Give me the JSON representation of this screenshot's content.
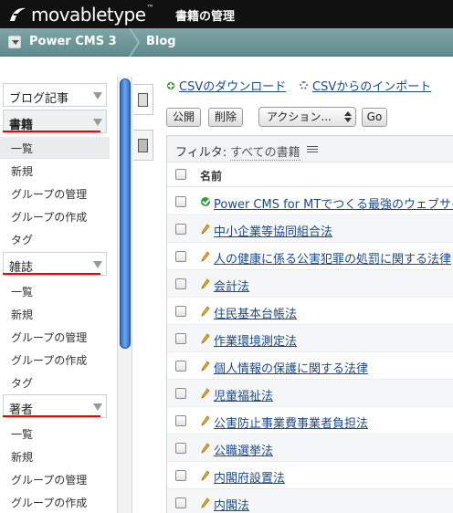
{
  "header": {
    "logo_text": "movabletype",
    "logo_tm": "™",
    "page_title": "書籍の管理"
  },
  "breadcrumb": {
    "site": "Power CMS 3",
    "blog": "Blog"
  },
  "sidebar": {
    "menus": [
      {
        "label": "ブログ記事",
        "bold": false
      },
      {
        "label": "書籍",
        "bold": true,
        "items": [
          "一覧",
          "新規",
          "グループの管理",
          "グループの作成",
          "タグ"
        ]
      },
      {
        "label": "雑誌",
        "bold": false,
        "items": [
          "一覧",
          "新規",
          "グループの管理",
          "グループの作成",
          "タグ"
        ]
      },
      {
        "label": "著者",
        "bold": false,
        "items": [
          "一覧",
          "新規",
          "グループの管理",
          "グループの作成"
        ]
      }
    ]
  },
  "actions": {
    "download_csv": "CSVのダウンロード",
    "import_csv": "CSVからのインポート"
  },
  "toolbar": {
    "publish": "公開",
    "delete": "削除",
    "action_select": "アクション...",
    "go": "Go"
  },
  "listing": {
    "filter_label": "フィルタ:",
    "filter_value": "すべての書籍",
    "column_name": "名前",
    "rows": [
      {
        "title": "Power CMS for MTでつくる最強のウェブサイト",
        "status": "published"
      },
      {
        "title": "中小企業等協同組合法",
        "status": "draft"
      },
      {
        "title": "人の健康に係る公害犯罪の処罰に関する法律",
        "status": "draft"
      },
      {
        "title": "会計法",
        "status": "draft"
      },
      {
        "title": "住民基本台帳法",
        "status": "draft"
      },
      {
        "title": "作業環境測定法",
        "status": "draft"
      },
      {
        "title": "個人情報の保護に関する法律",
        "status": "draft"
      },
      {
        "title": "児童福祉法",
        "status": "draft"
      },
      {
        "title": "公害防止事業費事業者負担法",
        "status": "draft"
      },
      {
        "title": "公職選挙法",
        "status": "draft"
      },
      {
        "title": "内閣府設置法",
        "status": "draft"
      },
      {
        "title": "内閣法",
        "status": "draft"
      }
    ]
  },
  "colors": {
    "topbar": "#111111",
    "crumbbar": "#6f999c",
    "link": "#1a4a8a",
    "underline": "#e00000",
    "scroll_thumb": "#2d6dc7"
  }
}
